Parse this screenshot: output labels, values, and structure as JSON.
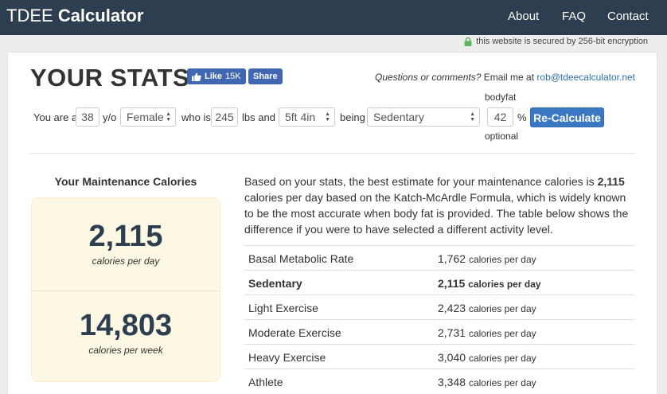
{
  "nav": {
    "brand_light": "TDEE",
    "brand_bold": "Calculator",
    "links": [
      "About",
      "FAQ",
      "Contact"
    ]
  },
  "security": {
    "text": "this website is secured by 256-bit encryption",
    "icon": "lock-icon",
    "icon_color": "#5cb85c"
  },
  "header": {
    "title": "YOUR STATS",
    "fb_like_label": "Like",
    "fb_like_count": "15K",
    "fb_share_label": "Share",
    "contact_question": "Questions or comments?",
    "contact_email_prefix": " Email me at ",
    "contact_email": "rob@tdeecalculator.net"
  },
  "form": {
    "you_are_label": "You are a",
    "age": "38",
    "age_unit": "y/o",
    "gender": "Female",
    "who_is_label": "who is",
    "weight": "245",
    "weight_unit_label": "lbs and",
    "height": "5ft 4in",
    "being_label": "being",
    "activity": "Sedentary",
    "bodyfat_label": "bodyfat",
    "bodyfat": "42",
    "bodyfat_unit": "%",
    "optional_label": "optional",
    "submit_label": "Re-Calculate"
  },
  "results": {
    "title": "Your Maintenance Calories",
    "daily_value": "2,115",
    "daily_label": "calories per day",
    "weekly_value": "14,803",
    "weekly_label": "calories per week",
    "desc_part1": "Based on your stats, the best estimate for your maintenance calories is ",
    "desc_bold": "2,115",
    "desc_part2": " calories per day based on the Katch-McArdle Formula, which is widely known to be the most accurate when body fat is provided. The table below shows the difference if you were to have selected a different activity level."
  },
  "activity_table": {
    "unit": "calories per day",
    "rows": [
      {
        "name": "Basal Metabolic Rate",
        "value": "1,762"
      },
      {
        "name": "Sedentary",
        "value": "2,115"
      },
      {
        "name": "Light Exercise",
        "value": "2,423"
      },
      {
        "name": "Moderate Exercise",
        "value": "2,731"
      },
      {
        "name": "Heavy Exercise",
        "value": "3,040"
      },
      {
        "name": "Athlete",
        "value": "3,348"
      }
    ]
  },
  "colors": {
    "navbar": "#2c3e50",
    "accent_blue": "#3a78c3",
    "facebook": "#4267b2",
    "highlight_box": "#fcf8e3"
  }
}
